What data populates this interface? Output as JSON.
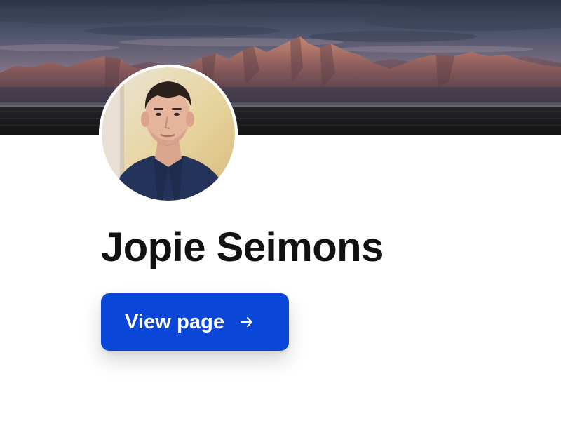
{
  "profile": {
    "name": "Jopie Seimons",
    "cover_image": "mountain-range-sunset",
    "avatar_image": "profile-photo"
  },
  "actions": {
    "view_page_label": "View page",
    "view_page_icon": "arrow-right-icon"
  },
  "colors": {
    "accent": "#0a47d8",
    "name_text": "#111111",
    "button_text": "#ffffff",
    "background": "#ffffff"
  }
}
